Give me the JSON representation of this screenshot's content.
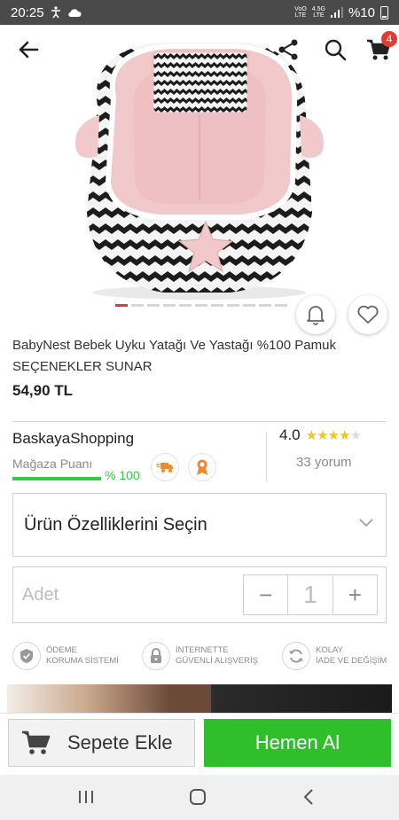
{
  "status_bar": {
    "time": "20:25",
    "carrier_top": "VoO",
    "carrier_bottom": "LTE",
    "network_top": "4.5G",
    "network_bottom": "LTE",
    "battery": "%10"
  },
  "header": {
    "cart_count": "4"
  },
  "gallery": {
    "image_count": 11,
    "active_index": 0
  },
  "product": {
    "title": "BabyNest Bebek Uyku Yatağı Ve Yastağı %100 Pamuk SEÇENEKLER SUNAR",
    "price": "54,90 TL"
  },
  "store": {
    "name": "BaskayaShopping",
    "score_label": "Mağaza Puanı",
    "score_percent": "% 100",
    "score_value": 1.0,
    "rating": "4.0",
    "rating_value": 4.0,
    "rating_max": 5,
    "reviews": "33 yorum"
  },
  "options": {
    "select_label": "Ürün Özelliklerini Seçin"
  },
  "quantity": {
    "label": "Adet",
    "value": "1",
    "minus": "−",
    "plus": "+"
  },
  "trust": [
    {
      "line1": "ÖDEME",
      "line2": "KORUMA SİSTEMİ",
      "icon": "shield-check-icon"
    },
    {
      "line1": "İNTERNETTE",
      "line2": "GÜVENLİ ALIŞVERİŞ",
      "icon": "lock-icon"
    },
    {
      "line1": "KOLAY",
      "line2": "İADE VE DEĞİŞİM",
      "icon": "refresh-icon"
    }
  ],
  "actions": {
    "add_to_cart": "Sepete Ekle",
    "buy_now": "Hemen Al"
  },
  "colors": {
    "accent_red": "#e23b30",
    "buy_green": "#2ebf2a",
    "score_green": "#2ecc40",
    "star": "#f5c518"
  }
}
